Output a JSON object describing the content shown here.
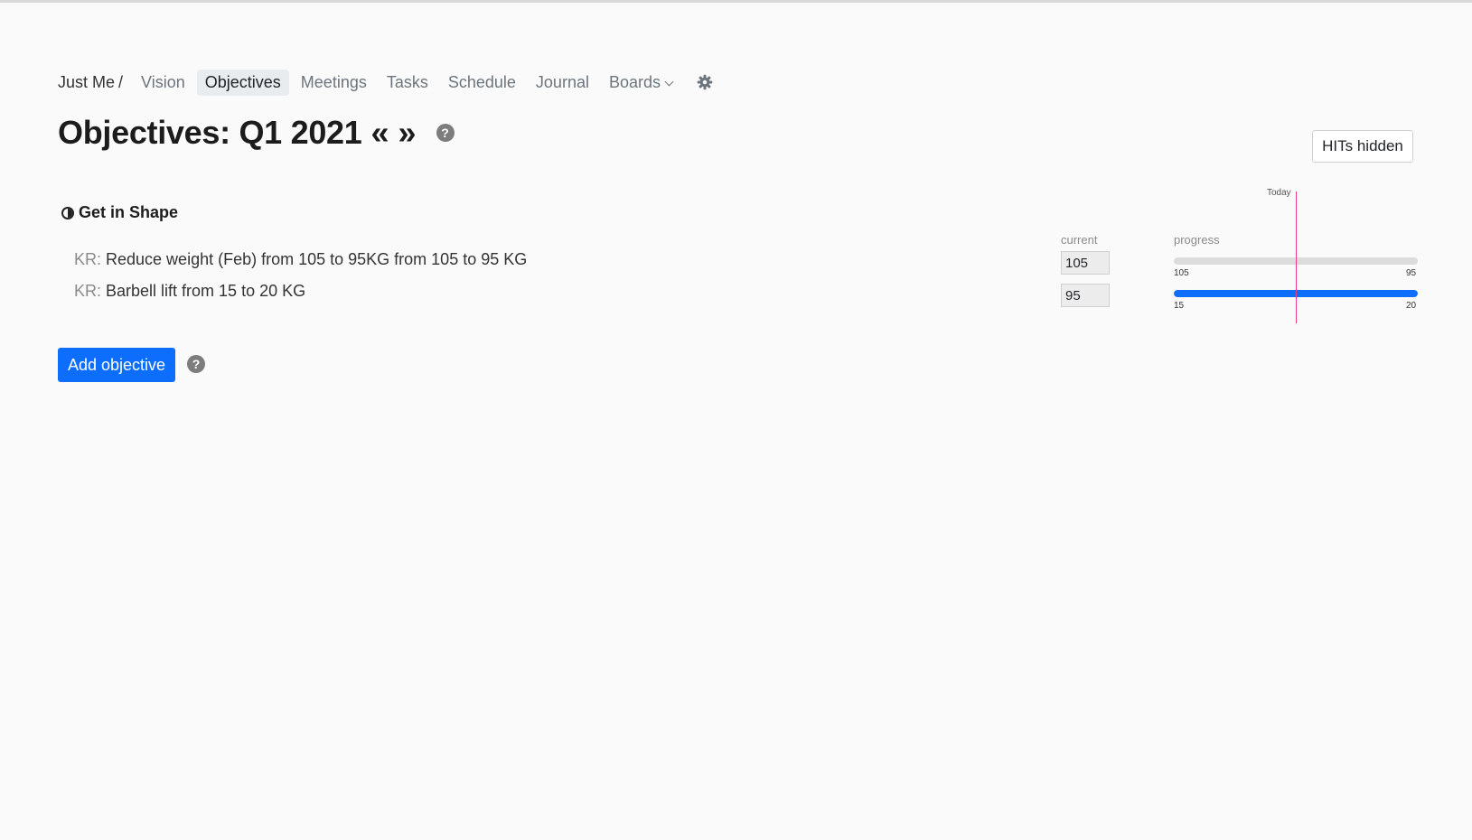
{
  "nav": {
    "team": "Just Me",
    "separator": "/",
    "items": [
      "Vision",
      "Objectives",
      "Meetings",
      "Tasks",
      "Schedule",
      "Journal",
      "Boards"
    ],
    "active_item": "Objectives"
  },
  "page": {
    "title": "Objectives: Q1 2021",
    "prev_arrow": "«",
    "next_arrow": "»",
    "help_glyph": "?"
  },
  "hits_button": {
    "label": "HITs hidden"
  },
  "objective": {
    "title": "Get in Shape",
    "key_results": [
      {
        "prefix": "KR:",
        "text": "Reduce weight (Feb) from 105 to 95KG from 105 to 95 KG",
        "current": "105",
        "start": "105",
        "end": "95",
        "progress_fraction": 0.0
      },
      {
        "prefix": "KR:",
        "text": "Barbell lift from 15 to 20 KG",
        "current": "95",
        "start": "15",
        "end": "20",
        "progress_fraction": 1.0
      }
    ]
  },
  "columns": {
    "current": "current",
    "progress": "progress"
  },
  "today_marker": {
    "label": "Today"
  },
  "add_objective": {
    "label": "Add objective"
  },
  "colors": {
    "accent": "#0d6efd",
    "today_line": "#e83e8c",
    "bar_track": "#dcdcdc"
  },
  "icons": {
    "settings": "gear-icon",
    "help": "help-circle-icon",
    "objective_status": "half-circle-icon"
  }
}
